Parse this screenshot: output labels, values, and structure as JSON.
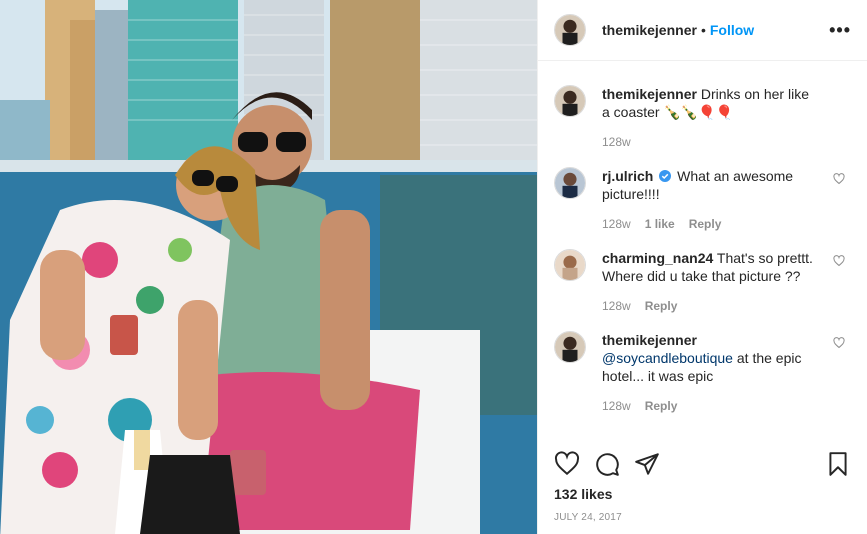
{
  "header": {
    "username": "themikejenner",
    "separator": "•",
    "follow_label": "Follow",
    "more_label": "•••"
  },
  "comments": [
    {
      "username": "themikejenner",
      "text": "Drinks on her like a coaster 🍾🍾🎈🎈",
      "time": "128w",
      "likes": "",
      "reply_label": "",
      "avatar": "man-avatar",
      "has_heart": false
    },
    {
      "username": "rj.ulrich",
      "verified": true,
      "text": "What an awesome picture!!!!",
      "time": "128w",
      "likes": "1 like",
      "reply_label": "Reply",
      "avatar": "man-suit-avatar",
      "has_heart": true
    },
    {
      "username": "charming_nan24",
      "text": "That's so prettt. Where did u take that picture ??",
      "time": "128w",
      "likes": "",
      "reply_label": "Reply",
      "avatar": "woman-avatar",
      "has_heart": true
    },
    {
      "username": "themikejenner",
      "mention": "@soycandleboutique",
      "text": "at the epic hotel... it was epic",
      "time": "128w",
      "likes": "",
      "reply_label": "Reply",
      "avatar": "man-avatar",
      "has_heart": true
    }
  ],
  "actions": {
    "like_icon": "heart-icon",
    "comment_icon": "comment-icon",
    "share_icon": "share-icon",
    "save_icon": "bookmark-icon"
  },
  "likes_text": "132 likes",
  "date_text": "JULY 24, 2017",
  "colors": {
    "accent": "#0095f6",
    "muted": "#8e8e8e",
    "text": "#262626",
    "verified": "#3897f0"
  }
}
